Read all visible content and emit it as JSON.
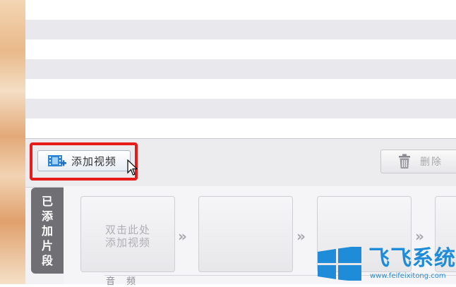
{
  "toolbar": {
    "add_video_label": "添加视频",
    "delete_label": "删除"
  },
  "clips_panel": {
    "tab_chars": [
      "已",
      "添",
      "加",
      "片",
      "段"
    ],
    "first_slot_hint_line1": "双击此处",
    "first_slot_hint_line2": "添加视频",
    "arrow_glyph": "»",
    "audio_label": "音 频"
  },
  "watermark": {
    "title": "飞飞系统",
    "url": "www.feifeixitong.com"
  },
  "colors": {
    "highlight": "#e81b1b",
    "brand": "#1e8cd8"
  },
  "icons": {
    "add_video": "film-plus-icon",
    "delete": "trash-icon",
    "cursor": "mouse-pointer-icon",
    "logo": "windows-logo-icon"
  }
}
